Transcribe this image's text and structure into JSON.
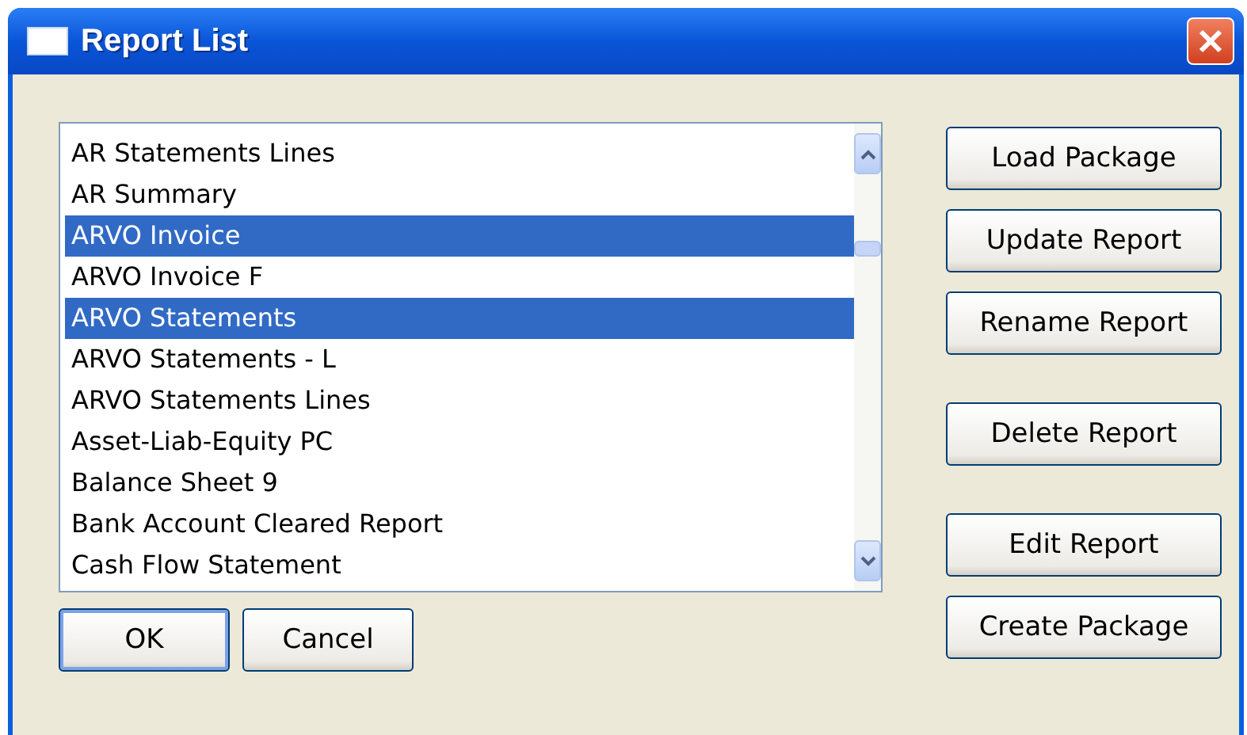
{
  "window": {
    "title": "Report List"
  },
  "reports": [
    {
      "label": "AR Statements Lines",
      "selected": false
    },
    {
      "label": "AR Summary",
      "selected": false
    },
    {
      "label": "ARVO Invoice",
      "selected": true
    },
    {
      "label": "ARVO Invoice F",
      "selected": false
    },
    {
      "label": "ARVO Statements",
      "selected": true
    },
    {
      "label": "ARVO Statements - L",
      "selected": false
    },
    {
      "label": "ARVO Statements Lines",
      "selected": false
    },
    {
      "label": "Asset-Liab-Equity PC",
      "selected": false
    },
    {
      "label": "Balance Sheet 9",
      "selected": false
    },
    {
      "label": "Bank Account Cleared Report",
      "selected": false
    },
    {
      "label": "Cash Flow Statement",
      "selected": false
    }
  ],
  "side_button_groups": [
    [
      "Load Package",
      "Update Report",
      "Rename Report"
    ],
    [
      "Delete Report"
    ],
    [
      "Edit Report",
      "Create Package"
    ]
  ],
  "footer_buttons": [
    {
      "label": "OK",
      "default": true
    },
    {
      "label": "Cancel",
      "default": false
    }
  ]
}
